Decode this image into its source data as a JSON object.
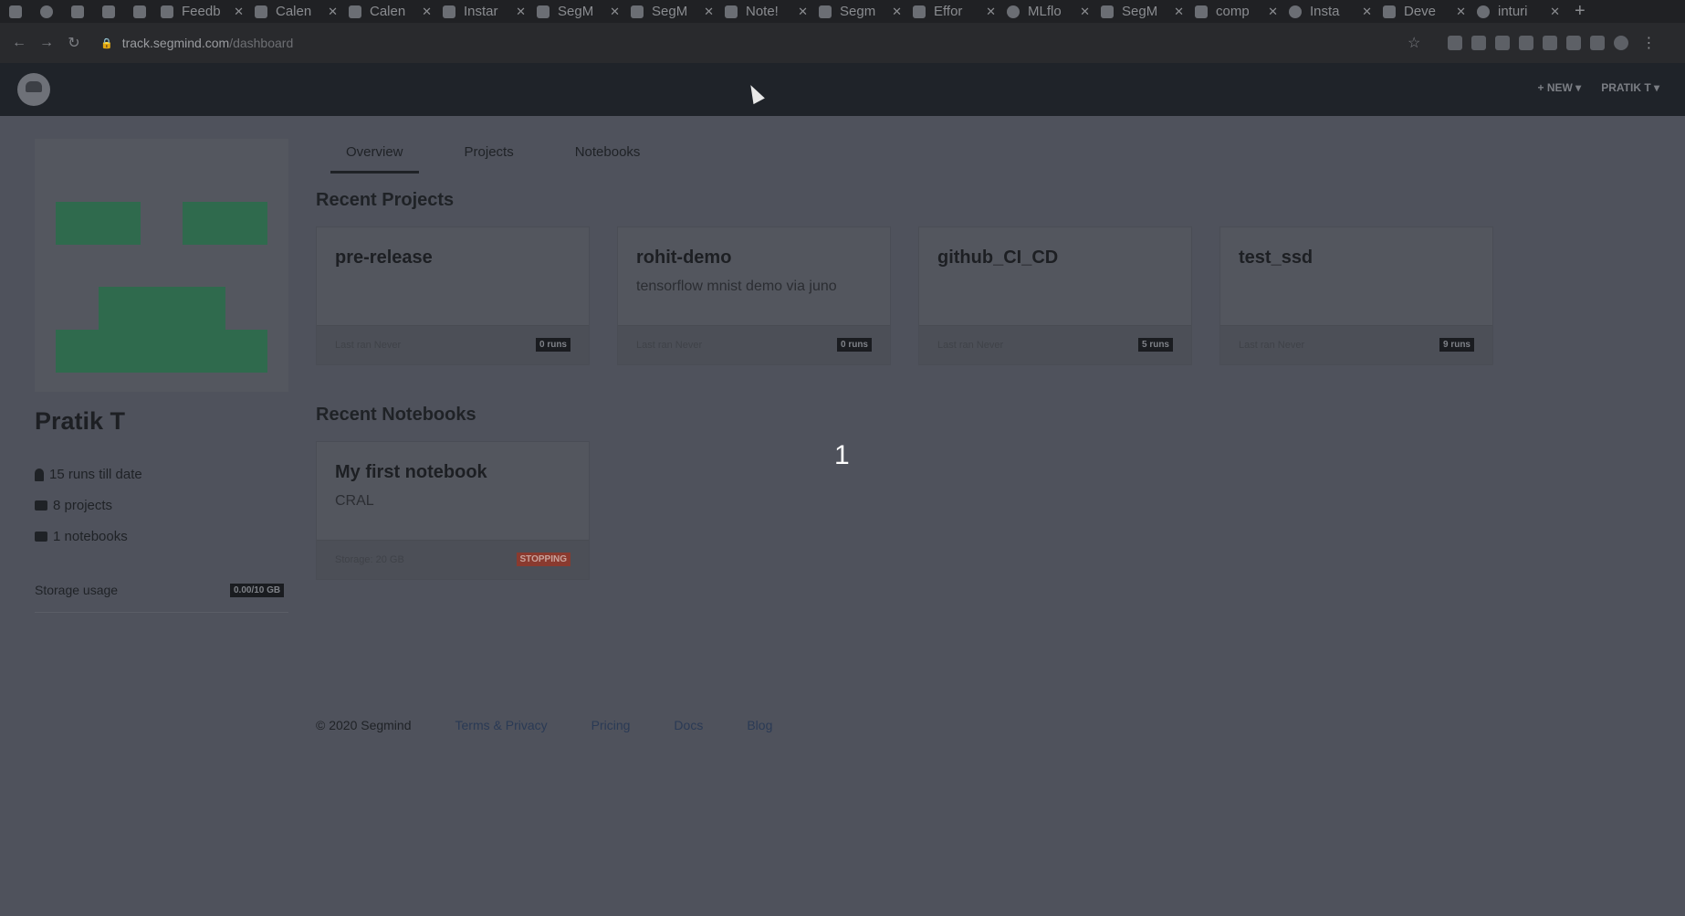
{
  "browser": {
    "tabs": [
      {
        "title": "",
        "pinned": true
      },
      {
        "title": "",
        "pinned": true
      },
      {
        "title": "",
        "pinned": true
      },
      {
        "title": "",
        "pinned": true
      },
      {
        "title": "",
        "pinned": true
      },
      {
        "title": "Feedb"
      },
      {
        "title": "Calen"
      },
      {
        "title": "Calen"
      },
      {
        "title": "Instar"
      },
      {
        "title": "SegM"
      },
      {
        "title": "SegM"
      },
      {
        "title": "Note!"
      },
      {
        "title": "Segm"
      },
      {
        "title": "Effor"
      },
      {
        "title": "MLflo"
      },
      {
        "title": "SegM"
      },
      {
        "title": "comp"
      },
      {
        "title": "Insta"
      },
      {
        "title": "Deve"
      },
      {
        "title": "inturi"
      }
    ],
    "url_host": "track.segmind.com",
    "url_path": "/dashboard"
  },
  "header": {
    "new_label": "+ NEW ▾",
    "user_label": "PRATIK T ▾"
  },
  "profile": {
    "name": "Pratik T",
    "runs": "15 runs till date",
    "projects": "8 projects",
    "notebooks": "1 notebooks",
    "storage_label": "Storage usage",
    "storage_value": "0.00/10 GB"
  },
  "tabs": [
    "Overview",
    "Projects",
    "Notebooks"
  ],
  "recent_projects_title": "Recent Projects",
  "projects": [
    {
      "name": "pre-release",
      "desc": "",
      "last_ran": "Last ran Never",
      "runs": "0 runs"
    },
    {
      "name": "rohit-demo",
      "desc": "tensorflow mnist demo via juno",
      "last_ran": "Last ran Never",
      "runs": "0 runs"
    },
    {
      "name": "github_CI_CD",
      "desc": "",
      "last_ran": "Last ran Never",
      "runs": "5 runs"
    },
    {
      "name": "test_ssd",
      "desc": "",
      "last_ran": "Last ran Never",
      "runs": "9 runs"
    }
  ],
  "recent_notebooks_title": "Recent Notebooks",
  "notebooks": [
    {
      "name": "My first notebook",
      "desc": "CRAL",
      "storage": "Storage: 20 GB",
      "status": "STOPPING"
    }
  ],
  "overlay_number": "1",
  "footer": {
    "copyright": "© 2020 Segmind",
    "links": [
      "Terms & Privacy",
      "Pricing",
      "Docs",
      "Blog"
    ]
  }
}
